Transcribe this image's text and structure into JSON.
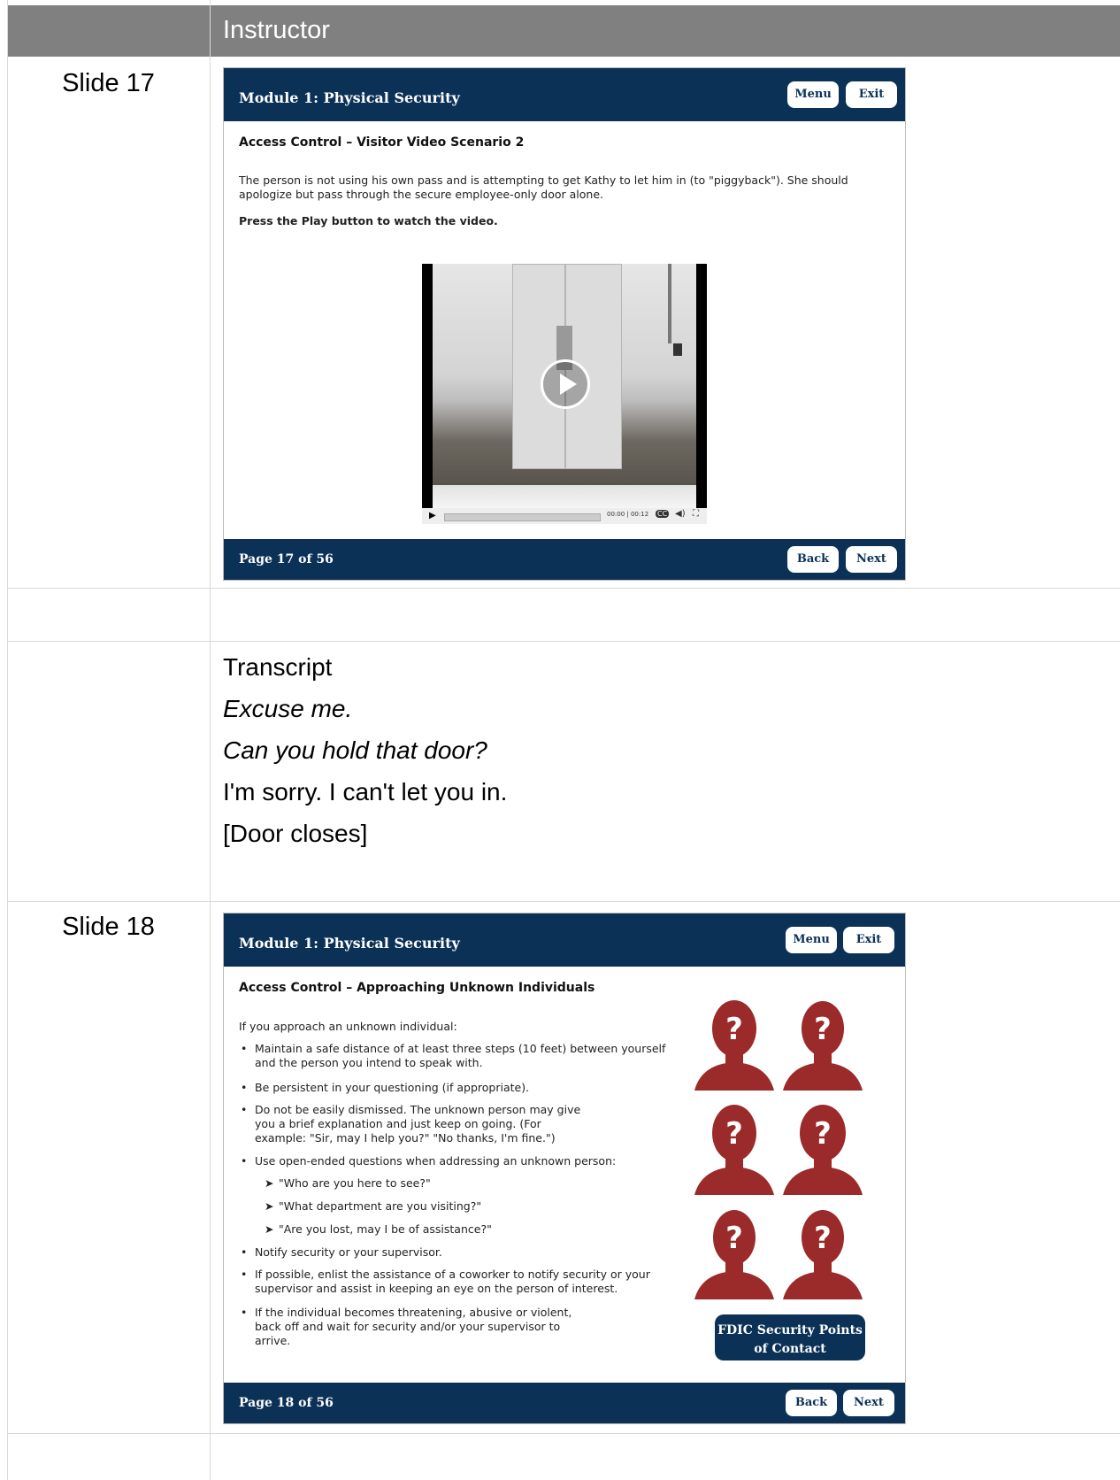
{
  "header": {
    "col2": "Instructor"
  },
  "rows": {
    "slide17_label": "Slide 17",
    "slide18_label": "Slide 18"
  },
  "slide17": {
    "module_title": "Module 1: Physical Security",
    "menu_label": "Menu",
    "exit_label": "Exit",
    "subtitle": "Access Control – Visitor Video Scenario 2",
    "body": "The person is not using his own pass and is attempting to get Kathy to let him in (to \"piggyback\"). She should apologize but pass through the secure employee-only door alone.",
    "instruction": "Press the Play button to watch the video.",
    "video": {
      "time": "00:00 | 00:12",
      "cc_label": "CC"
    },
    "page": "Page 17 of 56",
    "back_label": "Back",
    "next_label": "Next"
  },
  "transcript": {
    "heading": "Transcript",
    "lines": [
      "Excuse me.",
      "Can you hold that door?",
      "I'm sorry. I can't let you in.",
      "[Door closes]"
    ]
  },
  "slide18": {
    "module_title": "Module 1: Physical Security",
    "menu_label": "Menu",
    "exit_label": "Exit",
    "subtitle": "Access Control – Approaching Unknown Individuals",
    "intro": "If you approach an unknown individual:",
    "bullets": [
      "Maintain a safe distance of at least three steps (10 feet) between yourself and the person you intend to speak with.",
      "Be persistent in your questioning (if appropriate).",
      "Do not be easily dismissed. The unknown person may give you a brief explanation and just keep on going. (For example: \"Sir, may I help you?\" \"No thanks, I'm fine.\")",
      "Use open-ended questions when addressing an unknown person:",
      "Notify security or your supervisor.",
      "If possible, enlist the assistance of a coworker to notify security or your supervisor and assist in keeping an eye on the person of interest.",
      "If the individual becomes threatening, abusive or violent, back off and wait for security and/or your supervisor to arrive."
    ],
    "subbullets": [
      "\"Who are you here to see?\"",
      "\"What department are you visiting?\"",
      "\"Are you lost, may I be of assistance?\""
    ],
    "contact_button": "FDIC Security Points of Contact",
    "page": "Page 18 of 56",
    "back_label": "Back",
    "next_label": "Next",
    "icon_color": "#9b2a2a"
  }
}
